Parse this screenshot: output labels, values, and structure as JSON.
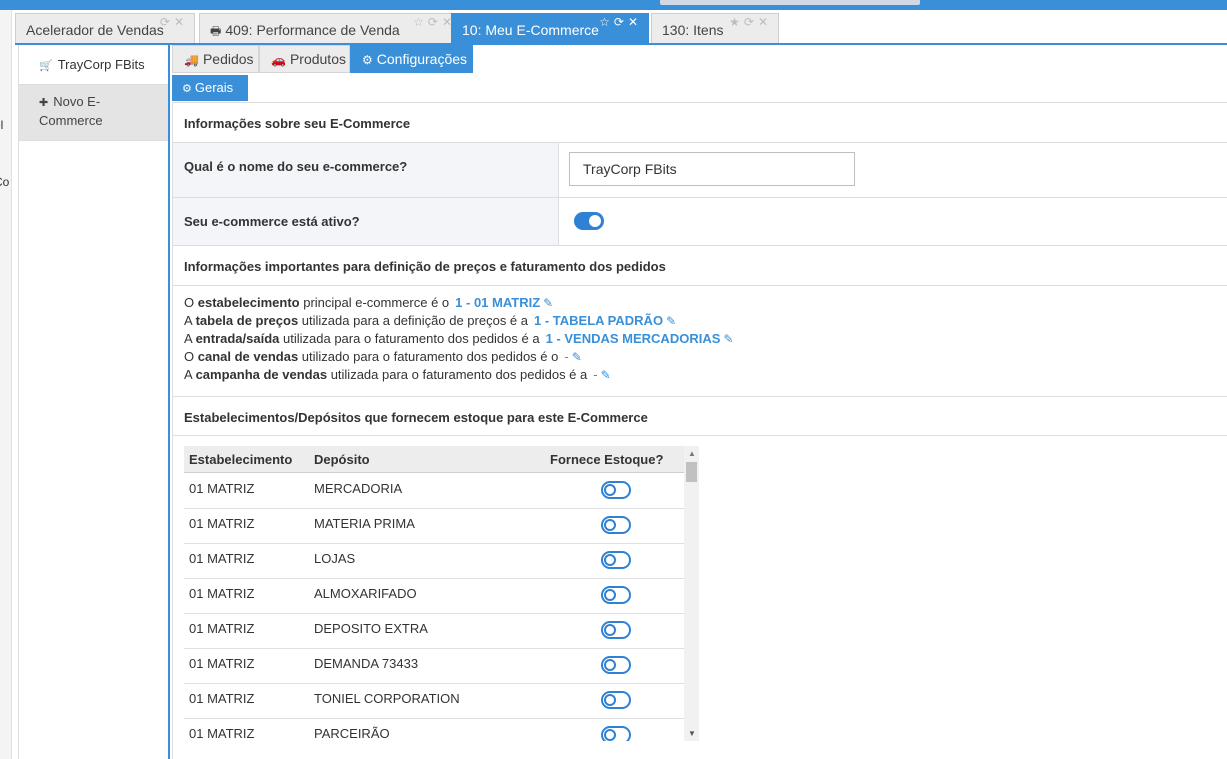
{
  "left_fragments": [
    "el",
    "Co"
  ],
  "tabs": [
    {
      "label": "Acelerador de Vendas",
      "active": false
    },
    {
      "label": "409: Performance de Venda",
      "active": false
    },
    {
      "label": "10: Meu E-Commerce",
      "active": true
    },
    {
      "label": "130: Itens",
      "active": false
    }
  ],
  "sidebar": {
    "items": [
      {
        "label": "TrayCorp FBits",
        "icon": "cart-icon"
      },
      {
        "label_line1": "Novo E-",
        "label_line2": "Commerce",
        "icon": "plus-icon"
      }
    ]
  },
  "subtabs": [
    {
      "label": "Pedidos",
      "icon": "truck-icon"
    },
    {
      "label": "Produtos",
      "icon": "car-icon"
    },
    {
      "label": "Configurações",
      "icon": "gears-icon",
      "active": true
    }
  ],
  "section_tab": {
    "label": "Gerais",
    "icon": "gears-icon"
  },
  "ecommerce_info": {
    "title": "Informações sobre seu E-Commerce",
    "name_question": "Qual é o nome do seu e-commerce?",
    "name_value": "TrayCorp FBits",
    "active_question": "Seu e-commerce está ativo?",
    "active": true
  },
  "pricing": {
    "title": "Informações importantes para definição de preços e faturamento dos pedidos",
    "lines": [
      {
        "pre": "O ",
        "bold": "estabelecimento",
        "post": " principal e-commerce é o",
        "value": "1 - 01 MATRIZ"
      },
      {
        "pre": "A ",
        "bold": "tabela de preços",
        "post": " utilizada para a definição de preços é a",
        "value": "1 - TABELA PADRÃO"
      },
      {
        "pre": "A ",
        "bold": "entrada/saída",
        "post": " utilizada para o faturamento dos pedidos é a",
        "value": "1 - VENDAS MERCADORIAS"
      },
      {
        "pre": "O ",
        "bold": "canal de vendas",
        "post": " utilizado para o faturamento dos pedidos é o",
        "value": "-"
      },
      {
        "pre": "A ",
        "bold": "campanha de vendas",
        "post": " utilizada para o faturamento dos pedidos é a",
        "value": "-"
      }
    ]
  },
  "stock": {
    "title": "Estabelecimentos/Depósitos que fornecem estoque para este E-Commerce",
    "columns": [
      "Estabelecimento",
      "Depósito",
      "Fornece Estoque?"
    ],
    "rows": [
      {
        "estab": "01 MATRIZ",
        "deposito": "MERCADORIA",
        "fornece": false
      },
      {
        "estab": "01 MATRIZ",
        "deposito": "MATERIA PRIMA",
        "fornece": false
      },
      {
        "estab": "01 MATRIZ",
        "deposito": "LOJAS",
        "fornece": false
      },
      {
        "estab": "01 MATRIZ",
        "deposito": "ALMOXARIFADO",
        "fornece": false
      },
      {
        "estab": "01 MATRIZ",
        "deposito": "DEPOSITO EXTRA",
        "fornece": false
      },
      {
        "estab": "01 MATRIZ",
        "deposito": "DEMANDA 73433",
        "fornece": false
      },
      {
        "estab": "01 MATRIZ",
        "deposito": "TONIEL CORPORATION",
        "fornece": false
      },
      {
        "estab": "01 MATRIZ",
        "deposito": "PARCEIRÃO",
        "fornece": false
      }
    ]
  },
  "colors": {
    "accent": "#3a8fd9",
    "toggle": "#2f81d4"
  }
}
